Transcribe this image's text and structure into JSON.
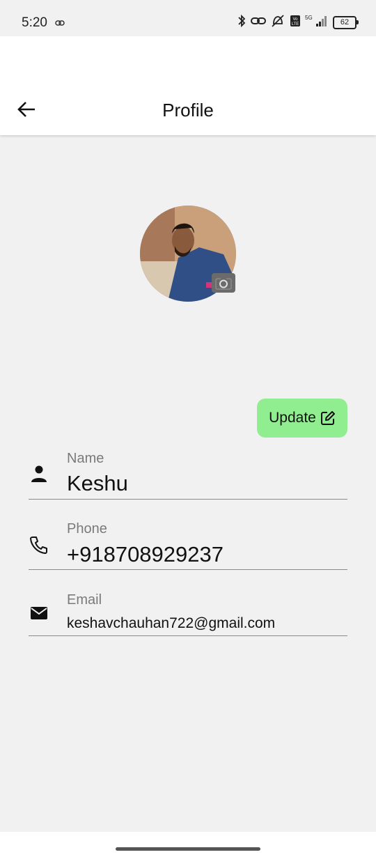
{
  "status_bar": {
    "time": "5:20",
    "battery": "62",
    "network": "5G",
    "icons": [
      "link-icon",
      "bluetooth-icon",
      "link-icon",
      "vibrate-off-icon",
      "volte-icon",
      "signal-icon",
      "battery-icon"
    ]
  },
  "appbar": {
    "title": "Profile",
    "back_icon": "arrow-left-icon"
  },
  "profile": {
    "avatar_alt": "profile photo",
    "camera_icon": "camera-icon"
  },
  "update_button": {
    "label": "Update",
    "icon": "edit-icon",
    "color": "#90ee90"
  },
  "fields": {
    "name": {
      "label": "Name",
      "value": "Keshu",
      "icon": "person-icon"
    },
    "phone": {
      "label": "Phone",
      "value": "+918708929237",
      "icon": "phone-icon"
    },
    "email": {
      "label": "Email",
      "value": "keshavchauhan722@gmail.com",
      "icon": "mail-icon"
    }
  },
  "colors": {
    "background": "#f1f1f1",
    "appbar": "#ffffff",
    "accent": "#90ee90"
  }
}
